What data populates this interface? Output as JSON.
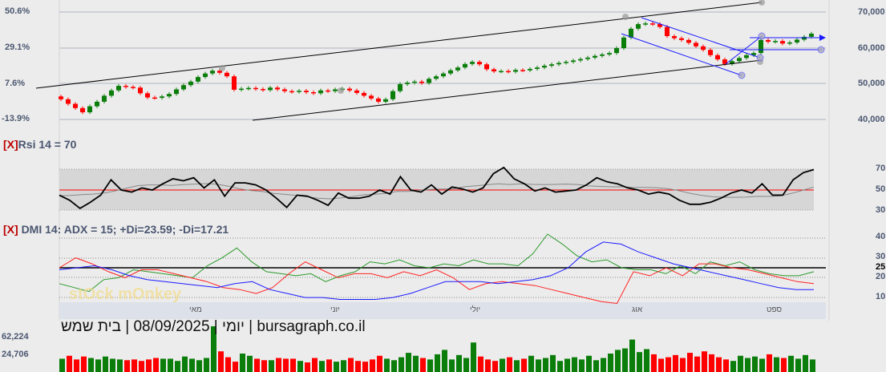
{
  "header": {
    "caption": "יומי | 08/09/2025 | בית שמש | bursagraph.co.il",
    "watermark": "stOck mOnkey"
  },
  "chart_data": [
    {
      "type": "candlestick",
      "title": "Price",
      "left_axis": [
        "50.6%",
        "29.1%",
        "7.6%",
        "-13.9%"
      ],
      "right_axis": [
        "70,000",
        "60,000",
        "50,000",
        "40,000"
      ],
      "ylim": [
        40000,
        70000
      ],
      "closes": [
        45500,
        44200,
        43000,
        41800,
        43500,
        44800,
        46500,
        48000,
        49300,
        49000,
        48800,
        47200,
        46000,
        45900,
        46300,
        47000,
        48300,
        49500,
        50500,
        51800,
        52800,
        53600,
        53000,
        52000,
        48200,
        48500,
        48700,
        48400,
        48100,
        48800,
        48300,
        47800,
        47600,
        47900,
        47500,
        47200,
        48000,
        47800,
        48300,
        48500,
        48000,
        47300,
        46500,
        45700,
        44800,
        45500,
        47800,
        49800,
        50200,
        50500,
        50100,
        51300,
        52000,
        52800,
        53700,
        54500,
        55500,
        56100,
        55400,
        54000,
        53400,
        53500,
        53300,
        53800,
        53700,
        54100,
        54500,
        55000,
        55400,
        55800,
        56100,
        56500,
        56900,
        57300,
        57800,
        58200,
        58600,
        60000,
        63000,
        65500,
        66800,
        67000,
        66800,
        66000,
        63400,
        62800,
        62300,
        61500,
        60500,
        59500,
        58000,
        56800,
        55500,
        56300,
        57200,
        58000,
        58600,
        62300,
        61800,
        62000,
        61300,
        61600,
        62400,
        63200,
        64100
      ],
      "up_color": "#0a7d0a",
      "down_color": "#ff0000"
    },
    {
      "type": "line",
      "title": "Rsi 14 = 70",
      "close_marker": "[X]",
      "yticks": [
        "70",
        "50",
        "30"
      ],
      "ylim": [
        0,
        100
      ],
      "band": [
        30,
        70
      ],
      "rsi": [
        45,
        40,
        32,
        38,
        45,
        60,
        50,
        48,
        52,
        50,
        56,
        61,
        59,
        62,
        52,
        60,
        44,
        57,
        57,
        55,
        50,
        42,
        33,
        45,
        44,
        40,
        35,
        47,
        42,
        42,
        44,
        50,
        46,
        63,
        50,
        48,
        55,
        46,
        53,
        51,
        48,
        52,
        66,
        72,
        61,
        56,
        49,
        52,
        48,
        49,
        50,
        55,
        62,
        58,
        56,
        52,
        50,
        46,
        48,
        46,
        40,
        36,
        36,
        38,
        42,
        47,
        50,
        47,
        56,
        45,
        45,
        60,
        67,
        70
      ]
    },
    {
      "type": "line",
      "title": "DMI 14: ADX = 15; +Di=23.59; -Di=17.21",
      "close_marker": "[X]",
      "yticks": [
        "40",
        "30",
        "25",
        "20",
        "10"
      ],
      "ylim": [
        5,
        45
      ],
      "plus_di": [
        17,
        15,
        13,
        19,
        20,
        24,
        23,
        22,
        21,
        20,
        26,
        30,
        35,
        28,
        23,
        22,
        21,
        22,
        18,
        21,
        23,
        28,
        27,
        29,
        26,
        25,
        27,
        26,
        29,
        27,
        27,
        26,
        32,
        42,
        37,
        31,
        28,
        29,
        25,
        24,
        24,
        22,
        26,
        22,
        28,
        26,
        28,
        24,
        22,
        21,
        21,
        23
      ],
      "minus_di": [
        25,
        30,
        27,
        23,
        20,
        24,
        24,
        22,
        20,
        18,
        15,
        14,
        12,
        15,
        22,
        28,
        24,
        20,
        22,
        22,
        20,
        23,
        21,
        24,
        20,
        14,
        17,
        18,
        17,
        16,
        14,
        12,
        10,
        8,
        7,
        23,
        21,
        25,
        21,
        27,
        27,
        25,
        24,
        22,
        20,
        18,
        17
      ],
      "adx": [
        24,
        25,
        26,
        24,
        21,
        19,
        18,
        17,
        16,
        15,
        17,
        18,
        14,
        12,
        10,
        10,
        9,
        9,
        9,
        10,
        12,
        15,
        18,
        18,
        18,
        17,
        18,
        19,
        21,
        25,
        33,
        38,
        37,
        33,
        30,
        27,
        25,
        23,
        21,
        19,
        17,
        15,
        14,
        14
      ],
      "colors": {
        "plus_di": "#2a9a2a",
        "minus_di": "#ff2020",
        "adx": "#1a1aff"
      }
    },
    {
      "type": "bar",
      "title": "Volume",
      "yticks": [
        "62,224",
        "24,706"
      ],
      "volume": [
        18,
        22,
        17,
        21,
        19,
        17,
        21,
        18,
        17,
        16,
        17,
        15,
        17,
        19,
        18,
        18,
        15,
        21,
        18,
        16,
        19,
        62,
        28,
        20,
        14,
        25,
        22,
        18,
        16,
        16,
        19,
        18,
        18,
        15,
        13,
        19,
        15,
        17,
        14,
        16,
        19,
        15,
        14,
        17,
        22,
        18,
        16,
        20,
        26,
        22,
        19,
        17,
        24,
        30,
        17,
        23,
        19,
        40,
        21,
        17,
        15,
        18,
        20,
        16,
        18,
        22,
        17,
        19,
        23,
        15,
        18,
        20,
        17,
        22,
        16,
        19,
        25,
        30,
        32,
        44,
        27,
        31,
        24,
        18,
        20,
        23,
        19,
        26,
        21,
        28,
        24,
        20,
        17,
        15,
        22,
        19,
        21,
        18,
        24,
        20,
        19,
        22,
        18,
        23,
        17
      ]
    },
    {
      "type": "axis",
      "months": [
        "מאי",
        "יוני",
        "יולי",
        "אוג",
        "ספט"
      ]
    }
  ]
}
